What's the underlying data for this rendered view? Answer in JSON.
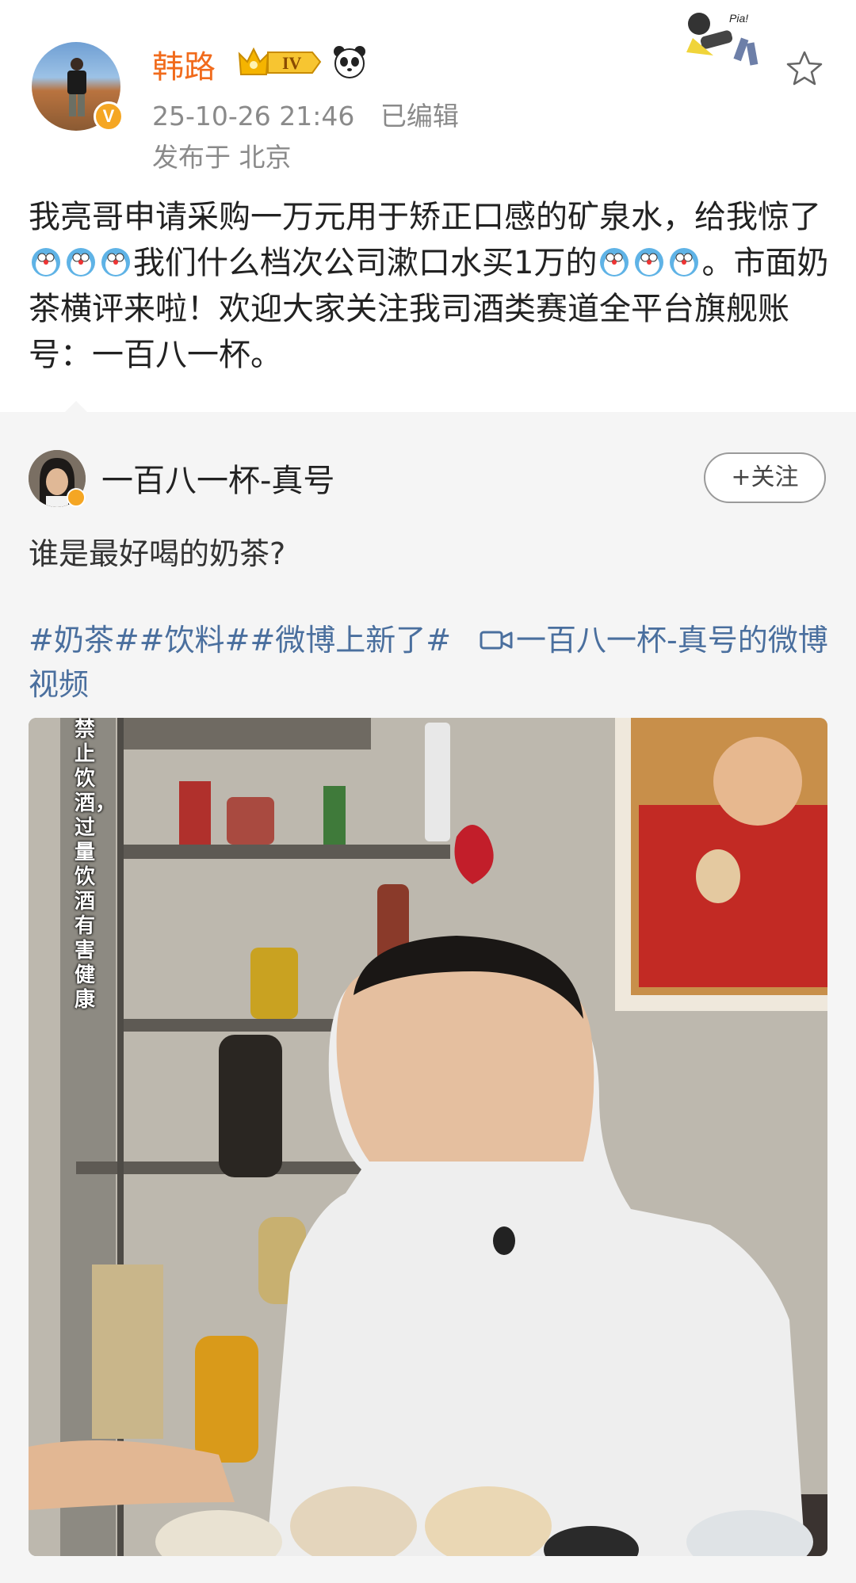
{
  "post": {
    "username": "韩路",
    "level_badge": "IV",
    "verified_mark": "V",
    "timestamp": "25-10-26 21:46",
    "edited": "已编辑",
    "location": "发布于 北京",
    "text_part1": "我亮哥申请采购一万元用于矫正口感的矿泉水，给我惊了",
    "text_part2": "我们什么档次公司漱口水买1万的",
    "text_part3": "。市面奶茶横评来啦！欢迎大家关注我司酒类赛道全平台旗舰账号：一百八一杯。",
    "sticker_text": "Pia!"
  },
  "repost": {
    "author": "一百八一杯-真号",
    "follow_label": "+关注",
    "text": "谁是最好喝的奶茶?",
    "tags": "#奶茶##饮料##微博上新了#",
    "video_link": "一百八一杯-真号的微博视频",
    "video_caption": "禁止饮酒，过量饮酒有害健康"
  },
  "colors": {
    "username": "#f16b1c",
    "link": "#4a6f9e",
    "meta": "#8a8a8a",
    "repost_bg": "#f5f5f5"
  }
}
